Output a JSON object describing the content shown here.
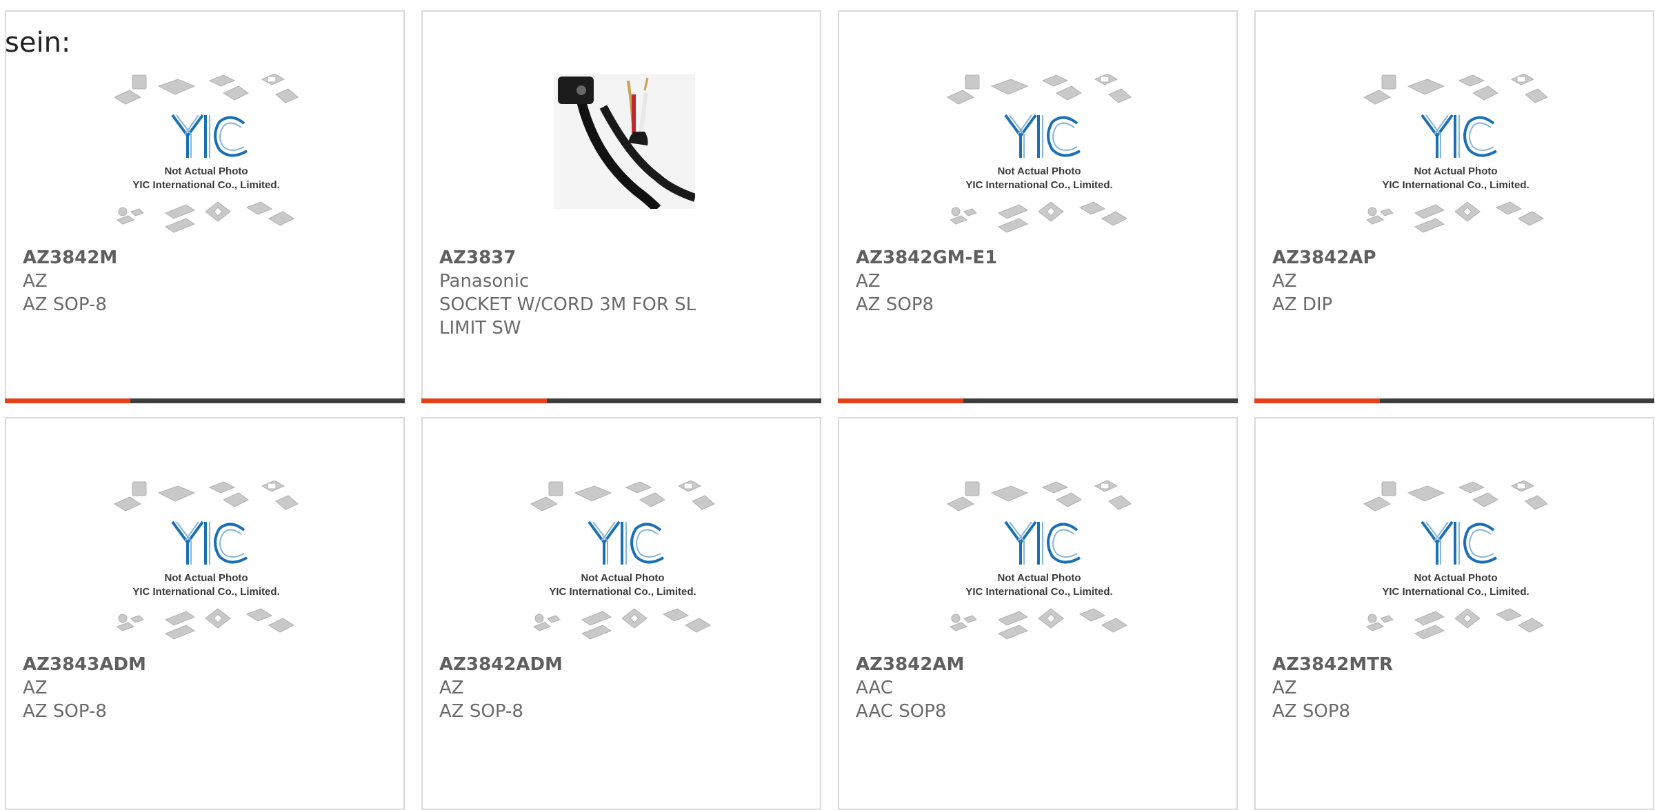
{
  "intro_text": "sein:",
  "colors": {
    "accent": "#e6401b",
    "bar": "#3d3d3d",
    "border": "#d9d9d9",
    "logo_blue": "#1a6fb5"
  },
  "placeholder": {
    "line1": "Not Actual Photo",
    "line2": "YIC International Co., Limited.",
    "logo": "YIC"
  },
  "cards": [
    {
      "part": "AZ3842M",
      "brand": "AZ",
      "desc": "AZ SOP-8",
      "image": "placeholder"
    },
    {
      "part": "AZ3837",
      "brand": "Panasonic",
      "desc": "SOCKET W/CORD 3M FOR SL LIMIT SW",
      "image": "cable-photo"
    },
    {
      "part": "AZ3842GM-E1",
      "brand": "AZ",
      "desc": "AZ SOP8",
      "image": "placeholder"
    },
    {
      "part": "AZ3842AP",
      "brand": "AZ",
      "desc": "AZ DIP",
      "image": "placeholder"
    },
    {
      "part": "AZ3843ADM",
      "brand": "AZ",
      "desc": "AZ SOP-8",
      "image": "placeholder"
    },
    {
      "part": "AZ3842ADM",
      "brand": "AZ",
      "desc": "AZ SOP-8",
      "image": "placeholder"
    },
    {
      "part": "AZ3842AM",
      "brand": "AAC",
      "desc": "AAC SOP8",
      "image": "placeholder"
    },
    {
      "part": "AZ3842MTR",
      "brand": "AZ",
      "desc": "AZ SOP8",
      "image": "placeholder"
    }
  ]
}
